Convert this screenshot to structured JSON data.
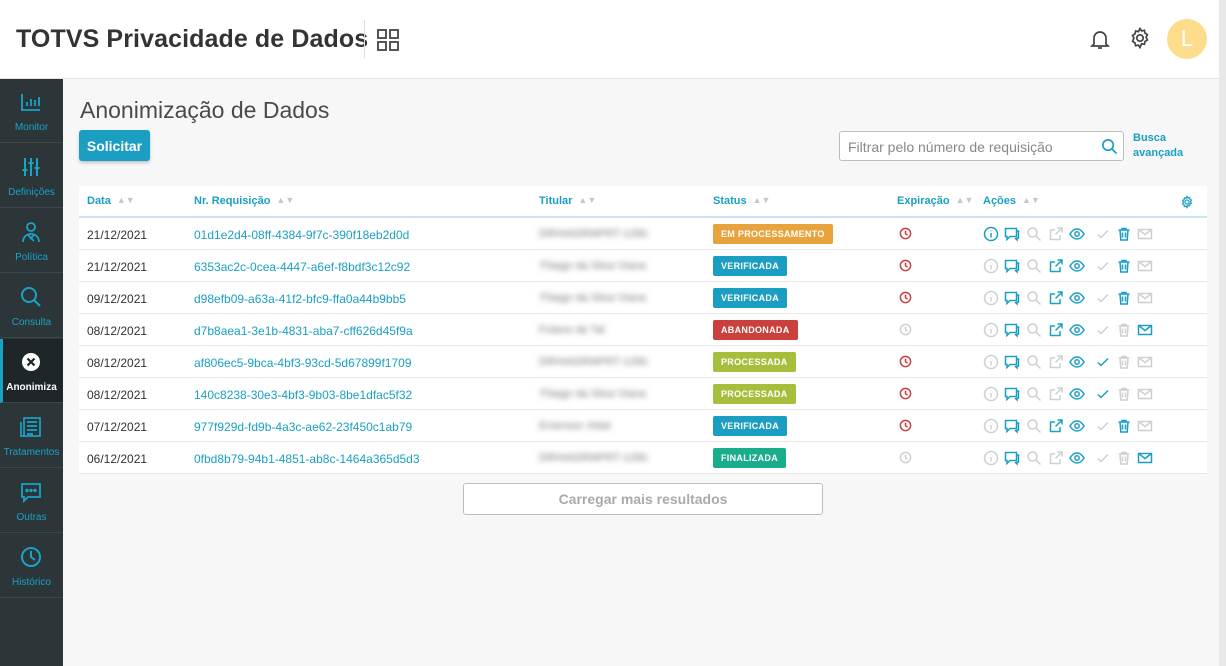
{
  "header": {
    "title": "TOTVS Privacidade de Dados",
    "avatar_initial": "L"
  },
  "sidebar": {
    "items": [
      {
        "label": "Monitor",
        "icon": "bar-chart-icon"
      },
      {
        "label": "Definições",
        "icon": "sliders-icon"
      },
      {
        "label": "Política",
        "icon": "user-policy-icon"
      },
      {
        "label": "Consulta",
        "icon": "search-icon"
      },
      {
        "label": "Anonimiza",
        "icon": "close-circle-icon",
        "active": true
      },
      {
        "label": "Tratamentos",
        "icon": "document-list-icon"
      },
      {
        "label": "Outras",
        "icon": "chat-icon"
      },
      {
        "label": "Histórico",
        "icon": "clock-icon"
      }
    ]
  },
  "main": {
    "title": "Anonimização de Dados",
    "request_button": "Solicitar",
    "filter_placeholder": "Filtrar pelo número de requisição",
    "advanced_search": "Busca avançada",
    "load_more": "Carregar mais resultados"
  },
  "table": {
    "columns": [
      "Data",
      "Nr. Requisição",
      "Titular",
      "Status",
      "Expiração",
      "Ações"
    ],
    "rows": [
      {
        "date": "21/12/2021",
        "request": "01d1e2d4-08ff-4384-9f7c-390f18eb2d0d",
        "holder": "DRHIADRMPRT-1280",
        "status": "EM PROCESSAMENTO",
        "status_color": "#e8a33c",
        "expiration_active": true,
        "actions": {
          "info": true,
          "chat": true,
          "search": false,
          "external": false,
          "view": true,
          "check": false,
          "trash": true,
          "mail": false
        }
      },
      {
        "date": "21/12/2021",
        "request": "6353ac2c-0cea-4447-a6ef-f8bdf3c12c92",
        "holder": "Thiago da Silva Viana",
        "status": "VERIFICADA",
        "status_color": "#1a9fc3",
        "expiration_active": true,
        "actions": {
          "info": false,
          "chat": true,
          "search": false,
          "external": true,
          "view": true,
          "check": false,
          "trash": true,
          "mail": false
        }
      },
      {
        "date": "09/12/2021",
        "request": "d98efb09-a63a-41f2-bfc9-ffa0a44b9bb5",
        "holder": "Thiago da Silva Viana",
        "status": "VERIFICADA",
        "status_color": "#1a9fc3",
        "expiration_active": true,
        "actions": {
          "info": false,
          "chat": true,
          "search": false,
          "external": true,
          "view": true,
          "check": false,
          "trash": true,
          "mail": false
        }
      },
      {
        "date": "08/12/2021",
        "request": "d7b8aea1-3e1b-4831-aba7-cff626d45f9a",
        "holder": "Fulano de Tal",
        "status": "ABANDONADA",
        "status_color": "#c9403c",
        "expiration_active": false,
        "actions": {
          "info": false,
          "chat": true,
          "search": false,
          "external": true,
          "view": true,
          "check": false,
          "trash": false,
          "mail": true
        }
      },
      {
        "date": "08/12/2021",
        "request": "af806ec5-9bca-4bf3-93cd-5d67899f1709",
        "holder": "DRHIADRMPRT-1280",
        "status": "PROCESSADA",
        "status_color": "#a5bf3c",
        "expiration_active": true,
        "actions": {
          "info": false,
          "chat": true,
          "search": false,
          "external": false,
          "view": true,
          "check": true,
          "trash": false,
          "mail": false
        }
      },
      {
        "date": "08/12/2021",
        "request": "140c8238-30e3-4bf3-9b03-8be1dfac5f32",
        "holder": "Thiago da Silva Viana",
        "status": "PROCESSADA",
        "status_color": "#a5bf3c",
        "expiration_active": true,
        "actions": {
          "info": false,
          "chat": true,
          "search": false,
          "external": false,
          "view": true,
          "check": true,
          "trash": false,
          "mail": false
        }
      },
      {
        "date": "07/12/2021",
        "request": "977f929d-fd9b-4a3c-ae62-23f450c1ab79",
        "holder": "Emerson Vidal",
        "status": "VERIFICADA",
        "status_color": "#1a9fc3",
        "expiration_active": true,
        "actions": {
          "info": false,
          "chat": true,
          "search": false,
          "external": true,
          "view": true,
          "check": false,
          "trash": true,
          "mail": false
        }
      },
      {
        "date": "06/12/2021",
        "request": "0fbd8b79-94b1-4851-ab8c-1464a365d5d3",
        "holder": "DRHIADRMPRT-1280",
        "status": "FINALIZADA",
        "status_color": "#1aad8c",
        "expiration_active": false,
        "actions": {
          "info": false,
          "chat": true,
          "search": false,
          "external": false,
          "view": true,
          "check": false,
          "trash": false,
          "mail": true
        }
      }
    ]
  },
  "colors": {
    "accent": "#1a9fc3",
    "sidebar_bg": "#2c3538",
    "expiration_red": "#c9403c",
    "icon_disabled": "#cfcfcf"
  }
}
